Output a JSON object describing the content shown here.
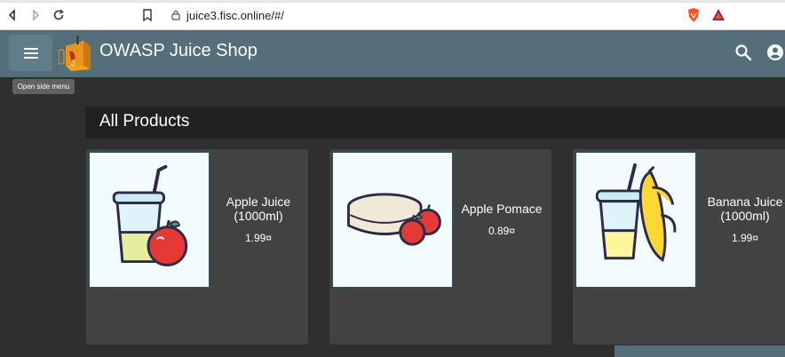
{
  "browser": {
    "url": "juice3.fisc.online/#/"
  },
  "toolbar": {
    "title": "OWASP Juice Shop",
    "menu_tooltip": "Open side menu"
  },
  "main": {
    "heading": "All Products",
    "products": [
      {
        "name": "Apple Juice (1000ml)",
        "price": "1.99¤"
      },
      {
        "name": "Apple Pomace",
        "price": "0.89¤"
      },
      {
        "name": "Banana Juice (1000ml)",
        "price": "1.99¤"
      }
    ]
  },
  "colors": {
    "toolbar": "#546e7a",
    "background": "#303030",
    "card": "#424242",
    "heading_bar": "#212121"
  }
}
